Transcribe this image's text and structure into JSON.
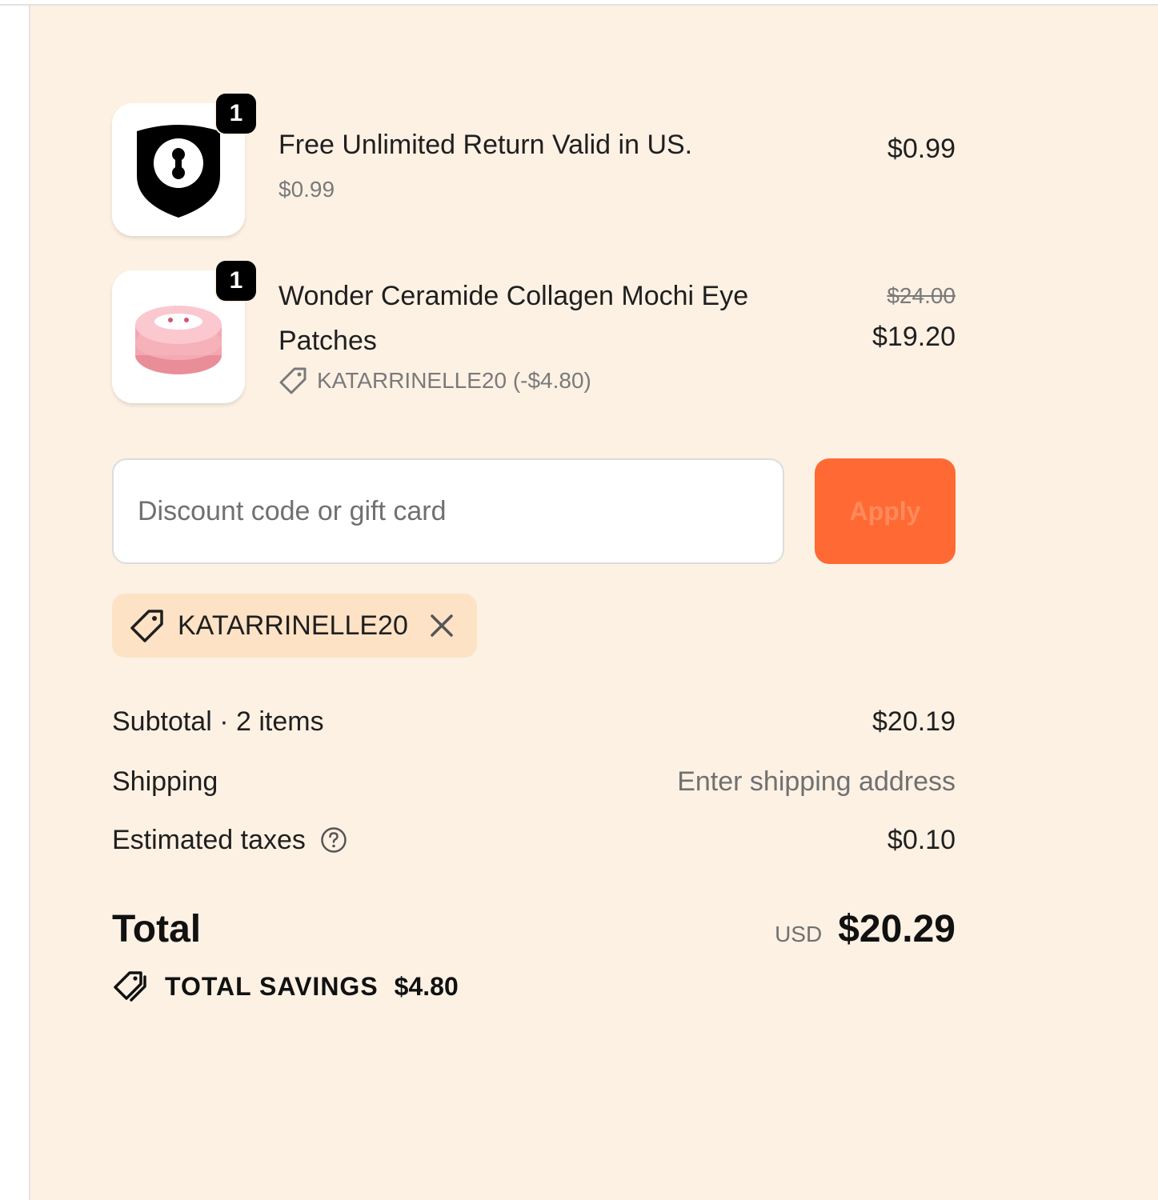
{
  "line_items": [
    {
      "name": "Free Unlimited Return Valid in US.",
      "unit_price": "$0.99",
      "price": "$0.99",
      "quantity": "1",
      "icon": "shield-lock-icon"
    },
    {
      "name": "Wonder Ceramide Collagen Mochi Eye Patches",
      "original_price": "$24.00",
      "price": "$19.20",
      "quantity": "1",
      "discount_text": "KATARRINELLE20 (-$4.80)",
      "icon": "eye-patch-jar-image"
    }
  ],
  "discount": {
    "placeholder": "Discount code or gift card",
    "value": "",
    "apply_label": "Apply"
  },
  "applied_code": {
    "code": "KATARRINELLE20"
  },
  "totals": {
    "subtotal_label": "Subtotal · 2 items",
    "subtotal_value": "$20.19",
    "shipping_label": "Shipping",
    "shipping_value": "Enter shipping address",
    "taxes_label": "Estimated taxes",
    "taxes_value": "$0.10",
    "total_label": "Total",
    "currency": "USD",
    "total_value": "$20.29",
    "savings_label": "TOTAL SAVINGS",
    "savings_value": "$4.80"
  },
  "colors": {
    "panel_background": "#fdf1e4",
    "accent": "#ff6a34",
    "chip_background": "#fde2c5"
  }
}
